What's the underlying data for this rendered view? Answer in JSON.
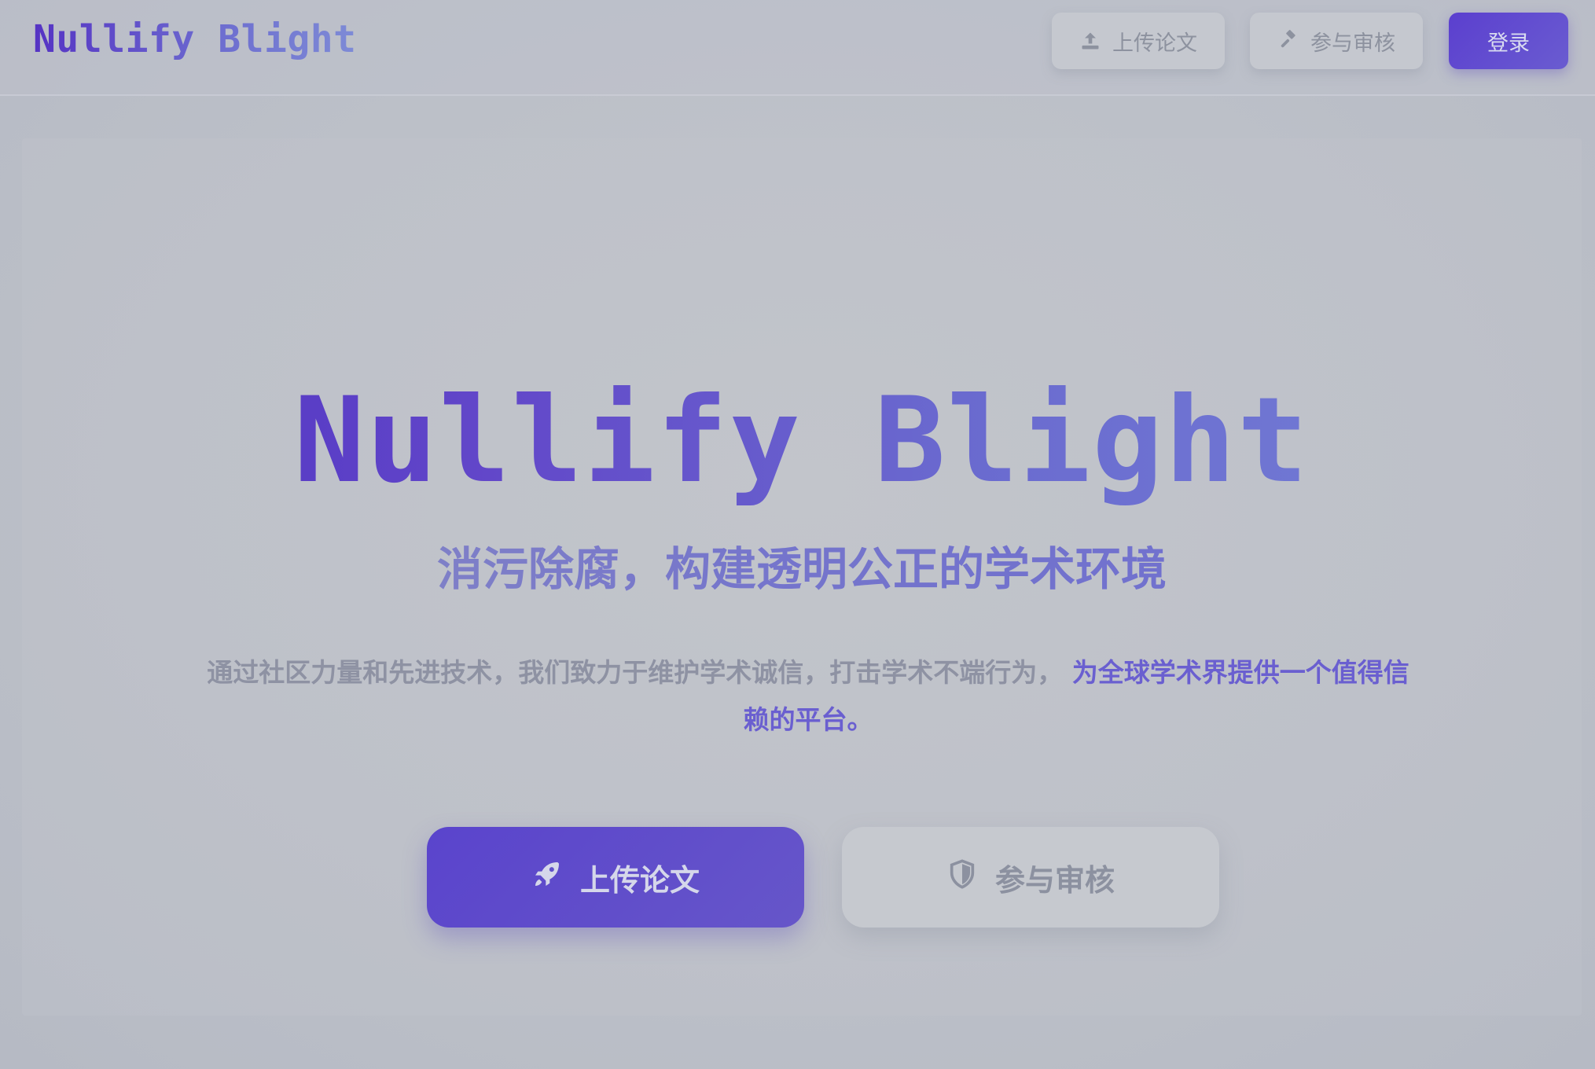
{
  "header": {
    "brand": "Nullify Blight",
    "nav": {
      "upload_label": "上传论文",
      "upload_icon": "upload-icon",
      "review_label": "参与审核",
      "review_icon": "gavel-icon",
      "login_label": "登录"
    }
  },
  "hero": {
    "title": "Nullify Blight",
    "subtitle": "消污除腐，构建透明公正的学术环境",
    "description": "通过社区力量和先进技术，我们致力于维护学术诚信，打击学术不端行为，",
    "description_highlight": "为全球学术界提供一个值得信赖的平台。",
    "cta_upload_label": "上传论文",
    "cta_upload_icon": "rocket-icon",
    "cta_review_label": "参与审核",
    "cta_review_icon": "shield-icon"
  },
  "colors": {
    "accent": "#5b3fcf",
    "background": "#bcc0c8",
    "muted_text": "#8e92a3"
  }
}
